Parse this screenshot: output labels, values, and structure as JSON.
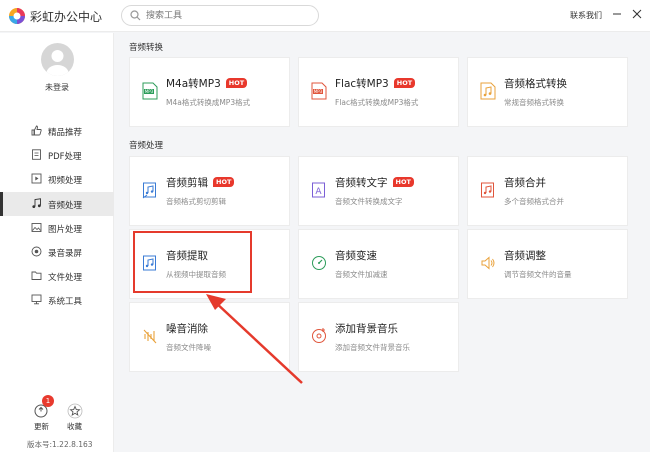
{
  "app": {
    "title": "彩虹办公中心",
    "contact": "联系我们"
  },
  "search": {
    "placeholder": "搜索工具"
  },
  "user": {
    "login_label": "未登录"
  },
  "nav": {
    "items": [
      {
        "label": "精品推荐",
        "icon": "thumbs-up-icon"
      },
      {
        "label": "PDF处理",
        "icon": "pdf-icon"
      },
      {
        "label": "视频处理",
        "icon": "video-icon"
      },
      {
        "label": "音频处理",
        "icon": "music-note-icon",
        "active": true
      },
      {
        "label": "图片处理",
        "icon": "image-icon"
      },
      {
        "label": "录音录屏",
        "icon": "record-icon"
      },
      {
        "label": "文件处理",
        "icon": "folder-icon"
      },
      {
        "label": "系统工具",
        "icon": "monitor-icon"
      }
    ]
  },
  "footer": {
    "update_label": "更新",
    "update_badge": "1",
    "favorite_label": "收藏",
    "version": "版本号:1.22.8.163"
  },
  "sections": {
    "conversion": {
      "title": "音频转换",
      "cards": [
        {
          "name": "M4a转MP3",
          "hot": "HOT",
          "desc": "M4a格式转换成MP3格式"
        },
        {
          "name": "Flac转MP3",
          "hot": "HOT",
          "desc": "Flac格式转换成MP3格式"
        },
        {
          "name": "音频格式转换",
          "desc": "常规音频格式转换"
        }
      ]
    },
    "processing": {
      "title": "音频处理",
      "cards": [
        {
          "name": "音频剪辑",
          "hot": "HOT",
          "desc": "音频格式剪切剪辑"
        },
        {
          "name": "音频转文字",
          "hot": "HOT",
          "desc": "音频文件转换成文字"
        },
        {
          "name": "音频合并",
          "desc": "多个音频格式合并"
        },
        {
          "name": "音频提取",
          "desc": "从视频中提取音频"
        },
        {
          "name": "音频变速",
          "desc": "音频文件加减速"
        },
        {
          "name": "音频调整",
          "desc": "调节音频文件的音量"
        },
        {
          "name": "噪音消除",
          "desc": "音频文件降噪"
        },
        {
          "name": "添加背景音乐",
          "desc": "添加音频文件背景音乐"
        }
      ]
    }
  },
  "colors": {
    "hot": "#e8382c",
    "highlight": "#e53a2c",
    "accent_blue": "#3a7bd5"
  }
}
